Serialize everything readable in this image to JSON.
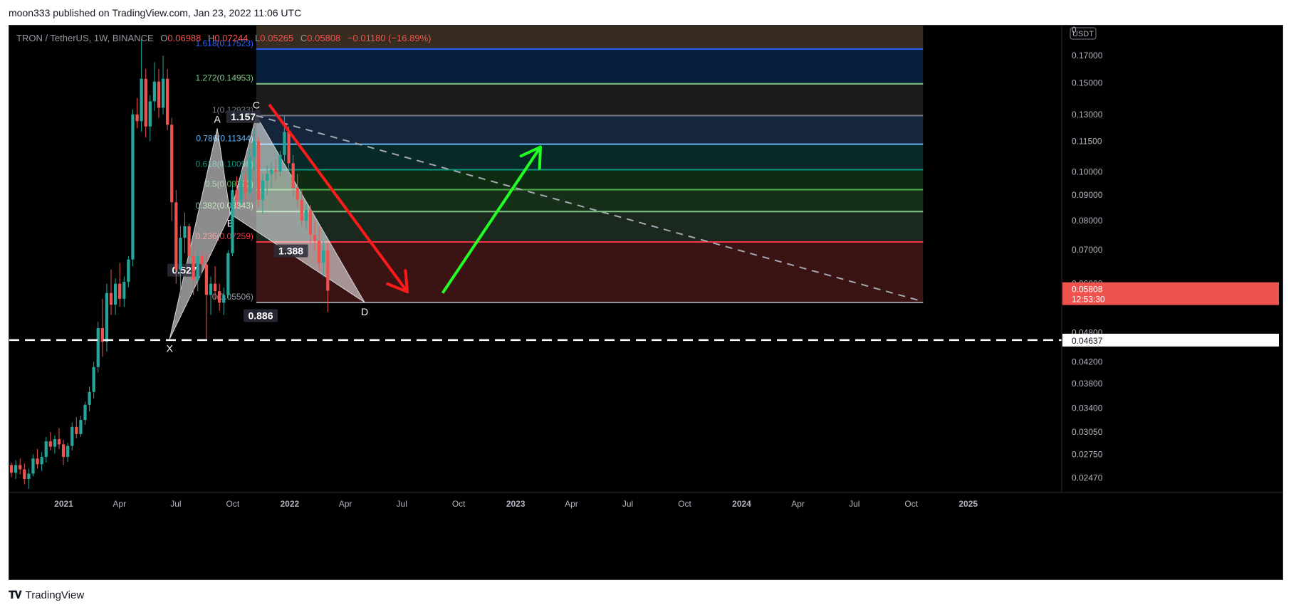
{
  "caption": {
    "author": "moon333",
    "published_text": "published on TradingView.com, Jan 23, 2022 11:06 UTC"
  },
  "brand": {
    "name": "TradingView",
    "logo_icon": "tradingview-logo-icon"
  },
  "colors": {
    "up": "#26a69a",
    "down": "#ef5350",
    "background": "#000000",
    "grid_text": "#b2b5be"
  },
  "chart_data": {
    "type": "candlestick",
    "symbol": "TRON / TetherUS, 1W, BINANCE",
    "ohlc_legend": {
      "o_label": "O",
      "o": "0.06988",
      "h_label": "H",
      "h": "0.07244",
      "l_label": "L",
      "l": "0.05265",
      "c_label": "C",
      "c": "0.05808",
      "change": "−0.01180 (−16.89%)"
    },
    "quote_currency": "USDT",
    "y_axis_ticks": [
      "0.17000",
      "0.15000",
      "0.13000",
      "0.11500",
      "0.10000",
      "0.09000",
      "0.08000",
      "0.07000",
      "0.06000",
      "0.04800",
      "0.04200",
      "0.03800",
      "0.03400",
      "0.03050",
      "0.02750",
      "0.02470"
    ],
    "y_axis_partial_top": "0",
    "x_axis_ticks": [
      "2021",
      "Apr",
      "Jul",
      "Oct",
      "2022",
      "Apr",
      "Jul",
      "Oct",
      "2023",
      "Apr",
      "Jul",
      "Oct",
      "2024",
      "Apr",
      "Jul",
      "Oct",
      "2025"
    ],
    "y_scale": "log",
    "ylim": [
      0.0232,
      0.195
    ],
    "xlim": [
      "2020-10-05",
      "2025-06-01"
    ],
    "current_price": {
      "value": "0.05808",
      "countdown": "12:53:30"
    },
    "horizontal_line": {
      "value": 0.04637,
      "label": "0.04637",
      "style": "dashed"
    },
    "fib_extension": {
      "start": "2021-11-08",
      "end": "2024-10-20",
      "levels": [
        {
          "ratio": "0",
          "price": 0.05506,
          "label": "0(0.05506)",
          "color": "#9598a1"
        },
        {
          "ratio": "0.236",
          "price": 0.07259,
          "label": "0.236(0.07259)",
          "color": "#f23645"
        },
        {
          "ratio": "0.382",
          "price": 0.08343,
          "label": "0.382(0.08343)",
          "color": "#81c784"
        },
        {
          "ratio": "0.5",
          "price": 0.0922,
          "label": "0.5(0.09220)",
          "color": "#4caf50"
        },
        {
          "ratio": "0.618",
          "price": 0.10098,
          "label": "0.618(0.10098)",
          "color": "#089981"
        },
        {
          "ratio": "0.786",
          "price": 0.11344,
          "label": "0.786(0.11344)",
          "color": "#64b5f6"
        },
        {
          "ratio": "1",
          "price": 0.12933,
          "label": "1(0.12933)",
          "color": "#787b86"
        },
        {
          "ratio": "1.272",
          "price": 0.14953,
          "label": "1.272(0.14953)",
          "color": "#81c784"
        },
        {
          "ratio": "1.618",
          "price": 0.17523,
          "label": "1.618(0.17523)",
          "color": "#2962ff"
        }
      ]
    },
    "harmonic_pattern": {
      "points": [
        {
          "name": "X",
          "date": "2021-06-21",
          "price": 0.0466
        },
        {
          "name": "A",
          "date": "2021-09-06",
          "price": 0.122
        },
        {
          "name": "B",
          "date": "2021-09-27",
          "price": 0.0825
        },
        {
          "name": "C",
          "date": "2021-11-08",
          "price": 0.1293
        },
        {
          "name": "D",
          "date": "2022-05-02",
          "price": 0.0551
        }
      ],
      "ratios": [
        {
          "label": "0.527",
          "date": "2021-07-15",
          "price": 0.063
        },
        {
          "label": "1.157",
          "date": "2021-10-18",
          "price": 0.127
        },
        {
          "label": "1.388",
          "date": "2022-01-03",
          "price": 0.0688
        },
        {
          "label": "0.886",
          "date": "2021-11-15",
          "price": 0.0512
        }
      ]
    },
    "trendline": {
      "start": {
        "date": "2021-11-08",
        "price": 0.1293
      },
      "end": {
        "date": "2024-10-20",
        "price": 0.0553
      },
      "style": "dashed"
    },
    "arrows": [
      {
        "color": "#ff1a1a",
        "from": {
          "date": "2021-11-29",
          "price": 0.136
        },
        "to": {
          "date": "2022-07-10",
          "price": 0.0578
        }
      },
      {
        "color": "#22ff22",
        "from": {
          "date": "2022-09-05",
          "price": 0.0575
        },
        "to": {
          "date": "2023-02-10",
          "price": 0.112
        }
      }
    ],
    "candles": [
      [
        0.0262,
        0.0265,
        0.0248,
        0.0253
      ],
      [
        0.0253,
        0.0268,
        0.0246,
        0.0262
      ],
      [
        0.0262,
        0.027,
        0.0251,
        0.0257
      ],
      [
        0.0257,
        0.0264,
        0.024,
        0.0246
      ],
      [
        0.0246,
        0.0258,
        0.0235,
        0.0252
      ],
      [
        0.0252,
        0.0275,
        0.0249,
        0.027
      ],
      [
        0.027,
        0.0282,
        0.0258,
        0.0263
      ],
      [
        0.0263,
        0.0278,
        0.0255,
        0.0272
      ],
      [
        0.0272,
        0.0298,
        0.0265,
        0.0292
      ],
      [
        0.0292,
        0.0305,
        0.028,
        0.0285
      ],
      [
        0.0285,
        0.03,
        0.0276,
        0.0295
      ],
      [
        0.0295,
        0.031,
        0.0282,
        0.0288
      ],
      [
        0.0288,
        0.0294,
        0.0262,
        0.0272
      ],
      [
        0.0272,
        0.029,
        0.0266,
        0.0286
      ],
      [
        0.0286,
        0.0318,
        0.028,
        0.0312
      ],
      [
        0.0312,
        0.0326,
        0.0296,
        0.0302
      ],
      [
        0.0302,
        0.0328,
        0.0298,
        0.0322
      ],
      [
        0.0322,
        0.035,
        0.0315,
        0.0345
      ],
      [
        0.0345,
        0.0375,
        0.0335,
        0.0366
      ],
      [
        0.0366,
        0.042,
        0.0355,
        0.041
      ],
      [
        0.041,
        0.0505,
        0.04,
        0.049
      ],
      [
        0.049,
        0.056,
        0.043,
        0.046
      ],
      [
        0.046,
        0.06,
        0.044,
        0.0575
      ],
      [
        0.0575,
        0.064,
        0.052,
        0.0545
      ],
      [
        0.0545,
        0.0615,
        0.052,
        0.06
      ],
      [
        0.06,
        0.066,
        0.054,
        0.056
      ],
      [
        0.056,
        0.062,
        0.054,
        0.0605
      ],
      [
        0.0605,
        0.068,
        0.059,
        0.067
      ],
      [
        0.067,
        0.133,
        0.065,
        0.13
      ],
      [
        0.13,
        0.14,
        0.122,
        0.126
      ],
      [
        0.126,
        0.183,
        0.12,
        0.153
      ],
      [
        0.153,
        0.16,
        0.117,
        0.123
      ],
      [
        0.123,
        0.142,
        0.115,
        0.138
      ],
      [
        0.138,
        0.165,
        0.132,
        0.151
      ],
      [
        0.151,
        0.16,
        0.128,
        0.134
      ],
      [
        0.134,
        0.17,
        0.13,
        0.153
      ],
      [
        0.153,
        0.16,
        0.121,
        0.124
      ],
      [
        0.124,
        0.128,
        0.08,
        0.087
      ],
      [
        0.087,
        0.092,
        0.06,
        0.064
      ],
      [
        0.064,
        0.078,
        0.057,
        0.074
      ],
      [
        0.074,
        0.083,
        0.069,
        0.078
      ],
      [
        0.078,
        0.079,
        0.066,
        0.068
      ],
      [
        0.068,
        0.072,
        0.057,
        0.061
      ],
      [
        0.061,
        0.0705,
        0.058,
        0.068
      ],
      [
        0.068,
        0.07,
        0.064,
        0.0655
      ],
      [
        0.0655,
        0.069,
        0.0466,
        0.057
      ],
      [
        0.057,
        0.062,
        0.052,
        0.06
      ],
      [
        0.06,
        0.065,
        0.056,
        0.058
      ],
      [
        0.058,
        0.06,
        0.053,
        0.055
      ],
      [
        0.055,
        0.059,
        0.052,
        0.057
      ],
      [
        0.057,
        0.07,
        0.056,
        0.069
      ],
      [
        0.069,
        0.095,
        0.068,
        0.092
      ],
      [
        0.092,
        0.098,
        0.085,
        0.088
      ],
      [
        0.088,
        0.1,
        0.086,
        0.096
      ],
      [
        0.096,
        0.099,
        0.088,
        0.091
      ],
      [
        0.091,
        0.111,
        0.09,
        0.107
      ],
      [
        0.107,
        0.122,
        0.1,
        0.115
      ],
      [
        0.115,
        0.118,
        0.085,
        0.088
      ],
      [
        0.088,
        0.099,
        0.0825,
        0.096
      ],
      [
        0.096,
        0.103,
        0.09,
        0.099
      ],
      [
        0.099,
        0.105,
        0.093,
        0.101
      ],
      [
        0.101,
        0.106,
        0.096,
        0.1
      ],
      [
        0.1,
        0.11,
        0.098,
        0.108
      ],
      [
        0.108,
        0.1293,
        0.105,
        0.12
      ],
      [
        0.12,
        0.123,
        0.1,
        0.104
      ],
      [
        0.104,
        0.108,
        0.089,
        0.093
      ],
      [
        0.093,
        0.099,
        0.085,
        0.088
      ],
      [
        0.088,
        0.092,
        0.078,
        0.08
      ],
      [
        0.08,
        0.086,
        0.077,
        0.084
      ],
      [
        0.084,
        0.086,
        0.072,
        0.075
      ],
      [
        0.075,
        0.08,
        0.07,
        0.073
      ],
      [
        0.073,
        0.078,
        0.064,
        0.066
      ],
      [
        0.066,
        0.073,
        0.062,
        0.0699
      ],
      [
        0.0699,
        0.0724,
        0.0527,
        0.0581
      ]
    ]
  }
}
